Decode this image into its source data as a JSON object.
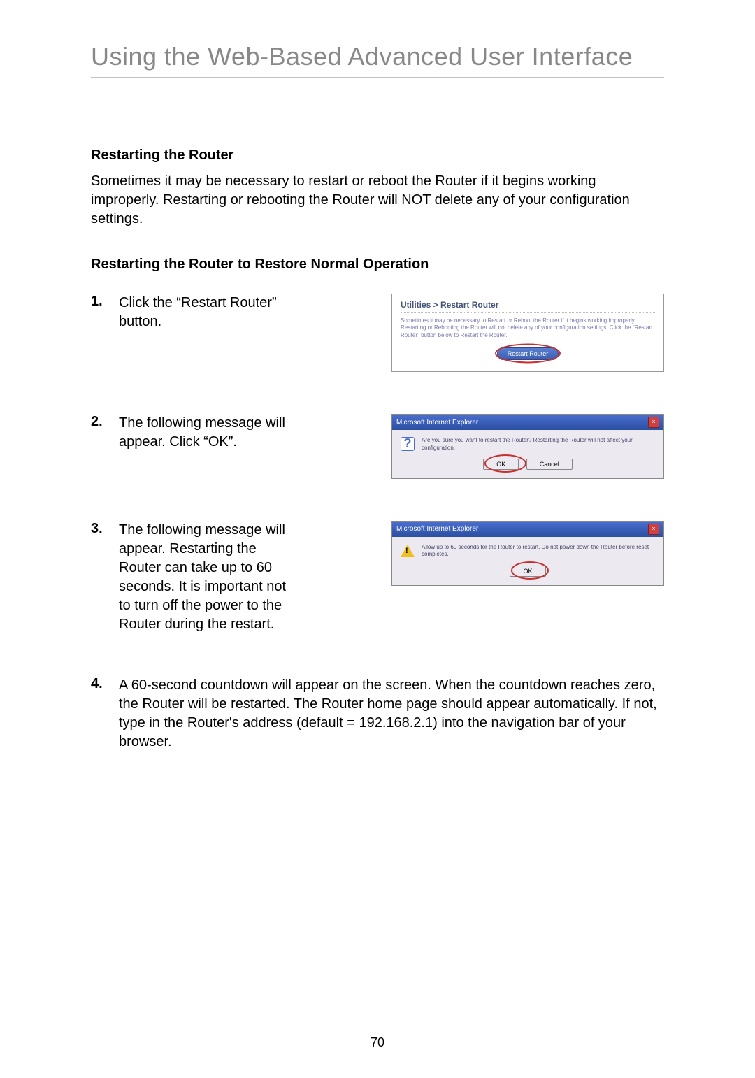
{
  "page": {
    "title": "Using the Web-Based Advanced User Interface",
    "number": "70"
  },
  "section": {
    "heading": "Restarting the Router",
    "body": "Sometimes it may be necessary to restart or reboot the Router if it begins working improperly. Restarting or rebooting the Router will NOT delete any of your configuration settings."
  },
  "subsection": {
    "heading": "Restarting the Router to Restore Normal Operation"
  },
  "steps": [
    {
      "num": "1.",
      "text": "Click the “Restart Router” button."
    },
    {
      "num": "2.",
      "text": "The following message will appear. Click “OK”."
    },
    {
      "num": "3.",
      "text": "The following message will appear. Restarting the Router can take up to 60 seconds. It is important not to turn off the power to the Router during the restart."
    },
    {
      "num": "4.",
      "text": "A 60-second countdown will appear on the screen. When the countdown reaches zero, the Router will be restarted. The Router home page should appear automatically. If not, type in the Router's address (default = 192.168.2.1) into the navigation bar of your browser."
    }
  ],
  "fig1": {
    "title": "Utilities > Restart Router",
    "desc": "Sometimes it may be necessary to Restart or Reboot the Router if it begins working improperly. Restarting or Rebooting the Router will not delete any of your configuration settings. Click the \"Restart Router\" button below to Restart the Router.",
    "button": "Restart Router"
  },
  "fig2": {
    "title": "Microsoft Internet Explorer",
    "msg": "Are you sure you want to restart the Router? Restarting the Router will not affect your configuration.",
    "ok": "OK",
    "cancel": "Cancel"
  },
  "fig3": {
    "title": "Microsoft Internet Explorer",
    "msg": "Allow up to 60 seconds for the Router to restart. Do not power down the Router before reset completes.",
    "ok": "OK"
  }
}
